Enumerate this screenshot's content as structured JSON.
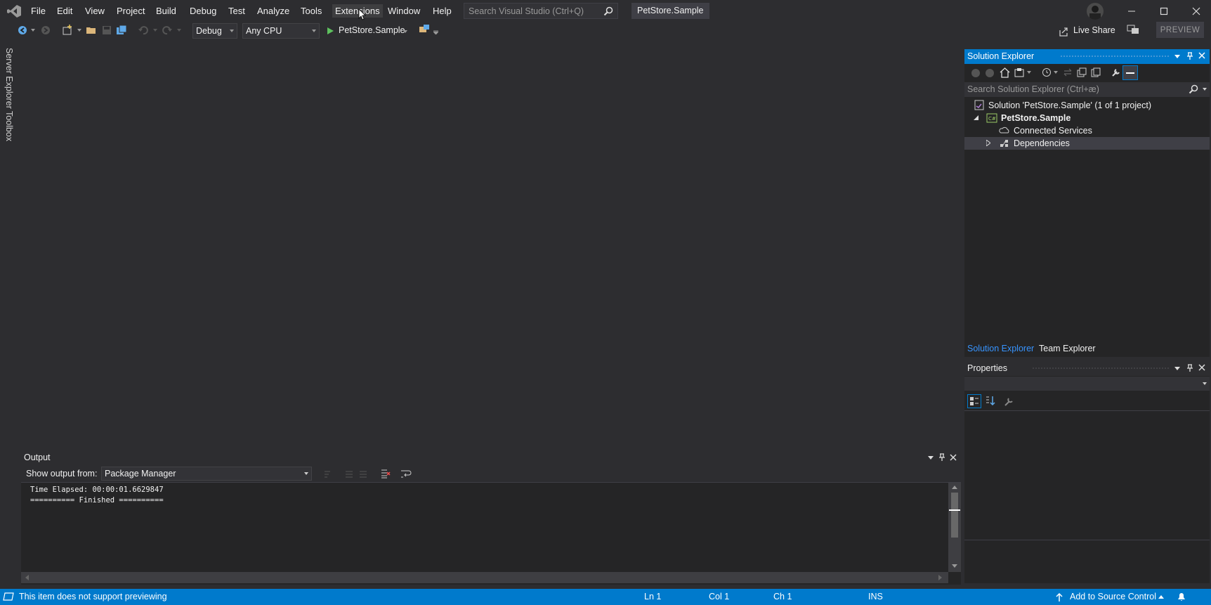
{
  "menu": {
    "items": [
      "File",
      "Edit",
      "View",
      "Project",
      "Build",
      "Debug",
      "Test",
      "Analyze",
      "Tools",
      "Extensions",
      "Window",
      "Help"
    ]
  },
  "search": {
    "placeholder": "Search Visual Studio (Ctrl+Q)"
  },
  "solution_title": "PetStore.Sample",
  "toolbar": {
    "configuration": "Debug",
    "platform": "Any CPU",
    "start_label": "PetStore.Sample",
    "live_share": "Live Share",
    "preview": "PREVIEW"
  },
  "left_tabs": [
    "Server Explorer",
    "Toolbox"
  ],
  "solution_explorer": {
    "title": "Solution Explorer",
    "search_placeholder": "Search Solution Explorer (Ctrl+æ)",
    "tree": [
      {
        "label": "Solution 'PetStore.Sample' (1 of 1 project)",
        "icon": "solution-icon"
      },
      {
        "label": "PetStore.Sample",
        "icon": "csharp-project-icon",
        "expander": "expanded"
      },
      {
        "label": "Connected Services",
        "icon": "connected-services-icon"
      },
      {
        "label": "Dependencies",
        "icon": "dependencies-icon",
        "expander": "collapsed",
        "selected": true
      }
    ],
    "tabs": [
      "Solution Explorer",
      "Team Explorer"
    ]
  },
  "properties": {
    "title": "Properties"
  },
  "output": {
    "title": "Output",
    "show_from_label": "Show output from:",
    "source": "Package Manager",
    "lines": [
      "Time Elapsed: 00:00:01.6629847",
      "========== Finished =========="
    ]
  },
  "status": {
    "message": "This item does not support previewing",
    "ln": "Ln 1",
    "col": "Col 1",
    "ch": "Ch 1",
    "mode": "INS",
    "source_control": "Add to Source Control"
  },
  "colors": {
    "accent": "#007acc",
    "background": "#2d2d30",
    "panel": "#252526"
  }
}
